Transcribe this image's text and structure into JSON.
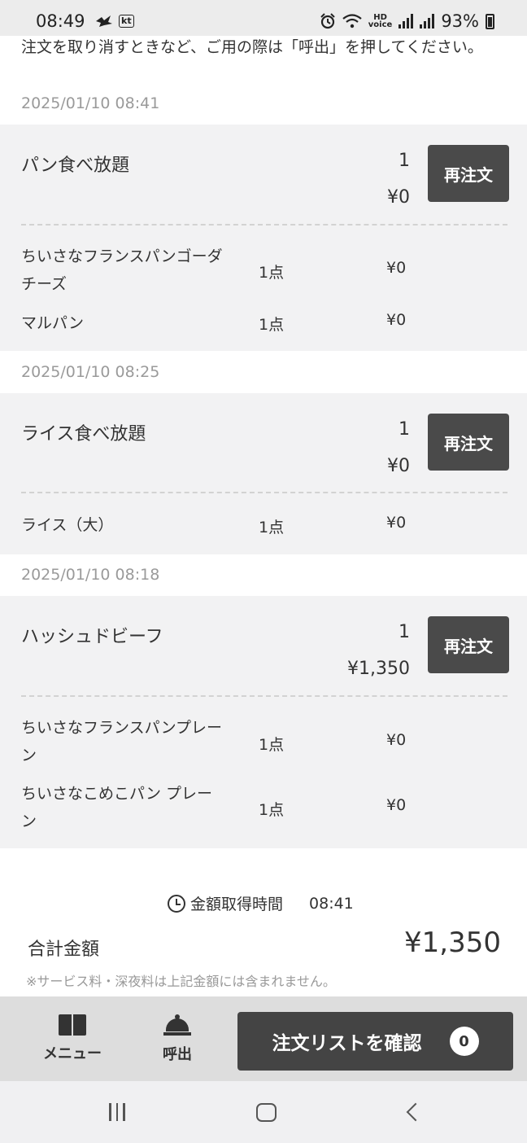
{
  "status_bar": {
    "time": "08:49",
    "carrier_badge": "kt",
    "battery": "93%",
    "icons": [
      "bird-icon",
      "kt-carrier-icon",
      "alarm-icon",
      "wifi-icon",
      "hd-voice-icon",
      "signal-icon",
      "signal-icon",
      "battery-icon"
    ]
  },
  "notice": "注文を取り消すときなど、ご用の際は「呼出」を押してください。",
  "orders": [
    {
      "timestamp": "2025/01/10 08:41",
      "name": "パン食べ放題",
      "qty": "1",
      "price": "¥0",
      "reorder_label": "再注文",
      "sub_items": [
        {
          "name": "ちいさなフランスパンゴーダチーズ",
          "qty": "1点",
          "price": "¥0"
        },
        {
          "name": "マルパン",
          "qty": "1点",
          "price": "¥0"
        }
      ]
    },
    {
      "timestamp": "2025/01/10 08:25",
      "name": "ライス食べ放題",
      "qty": "1",
      "price": "¥0",
      "reorder_label": "再注文",
      "sub_items": [
        {
          "name": "ライス（大）",
          "qty": "1点",
          "price": "¥0"
        }
      ]
    },
    {
      "timestamp": "2025/01/10 08:18",
      "name": "ハッシュドビーフ",
      "qty": "1",
      "price": "¥1,350",
      "reorder_label": "再注文",
      "sub_items": [
        {
          "name": "ちいさなフランスパンプレーン",
          "qty": "1点",
          "price": "¥0"
        },
        {
          "name": "ちいさなこめこパン プレーン",
          "qty": "1点",
          "price": "¥0"
        }
      ]
    }
  ],
  "totals": {
    "fetch_label": "金額取得時間",
    "fetch_time": "08:41",
    "total_label": "合計金額",
    "total_value": "¥1,350",
    "note": "※サービス料・深夜料は上記金額には含まれません。"
  },
  "bottom_bar": {
    "menu_label": "メニュー",
    "call_label": "呼出",
    "confirm_label": "注文リストを確認",
    "cart_count": "0"
  }
}
